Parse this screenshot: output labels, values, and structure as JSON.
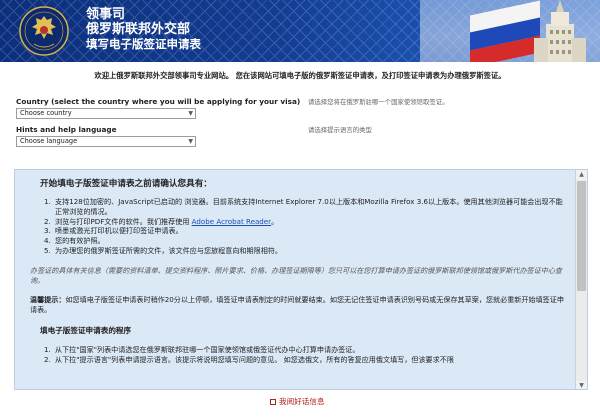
{
  "header": {
    "title_line1": "领事司",
    "title_line2": "俄罗斯联邦外交部",
    "title_line3": "填写电子版签证申请表"
  },
  "welcome": "欢迎上俄罗斯联邦外交部领事司专业网站。 您在该网站可填电子版的俄罗斯签证申请表，及打印签证申请表为办理俄罗斯签证。",
  "country": {
    "label": "Country (select the country where you will be applying for your visa)",
    "selected": "Choose country",
    "hint": "请选择您将在俄罗斯驻哪一个国家使领馆取签证。"
  },
  "language": {
    "label": "Hints and help language",
    "selected": "Choose language",
    "hint": "请选择提示语言的类型"
  },
  "panel": {
    "heading": "开始填电子版签证申请表之前请确认您具有：",
    "requirements": [
      {
        "num": "1.",
        "text": "支持128位加密的、JavaScript已启动的 浏览器。目前系统支持Internet Explorer 7.0以上版本和Mozilla Firefox 3.6以上版本。使用其他浏览器可能会出现不能正常浏览的情况。"
      },
      {
        "num": "2.",
        "text_before": "浏览与打印PDF文件的软件。我们推荐使用 ",
        "link": "Adobe Acrobat Reader",
        "text_after": "。"
      },
      {
        "num": "3.",
        "text": "喷墨或激光打印机以便打印签证申请表。"
      },
      {
        "num": "4.",
        "text": "您的有效护照。"
      },
      {
        "num": "5.",
        "text": "为办理您的俄罗斯签证所需的文件，该文件应与您旅程意向和期限相符。"
      }
    ],
    "italic_note": "办签证的具体有关信息（需要的资料清单、提交资料程序、照片要求、价格、办理签证期限等）您只可以在您打算申请办签证的俄罗斯联邦使领馆或俄罗斯代办签证中心查询。",
    "warning_label": "温馨提示：",
    "warning_text": "如您填电子版签证申请表时稍作20分以上停顿，填签证申请表制定的时间就要结束。如您无记住签证申请表识别号码或无保存其草案，您就必重新开始填签证申请表。",
    "procedure_heading": "填电子版签证申请表的程序",
    "steps": [
      {
        "num": "1.",
        "text": "从下拉\"国家\"列表中请选您在俄罗斯联邦驻哪一个国家使领馆或俄签证代办中心打算申请办签证。"
      },
      {
        "num": "2.",
        "text": "从下拉\"提示语言\"列表申请提示语言。该提示将说明您填写问题的意见。 如您选俄文，所有的答复应用俄文填写，但该要求不限"
      }
    ]
  },
  "footer": {
    "forgot_link": "我阅好话信息"
  },
  "colors": {
    "banner": "#123c92",
    "panel_bg": "#dbe9f7",
    "link": "#1a4fb8",
    "footer_link": "#b02020"
  }
}
